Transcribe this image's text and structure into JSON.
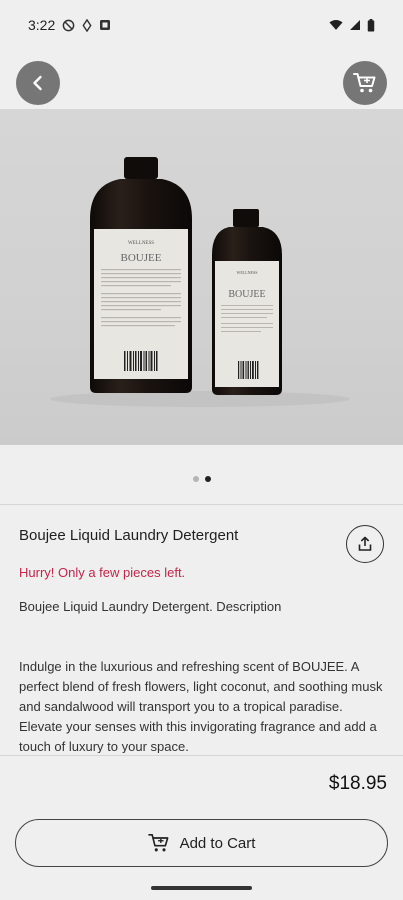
{
  "status_bar": {
    "time": "3:22"
  },
  "product": {
    "title": "Boujee Liquid Laundry Detergent",
    "stock_warning": "Hurry! Only a few pieces left.",
    "short_description": "Boujee Liquid Laundry Detergent. Description",
    "long_description": "Indulge in the luxurious and refreshing scent of BOUJEE. A perfect blend of fresh flowers, light coconut, and soothing musk and sandalwood will transport you to a tropical paradise. Elevate your senses with this invigorating fragrance and add a touch of luxury to your space.",
    "price": "$18.95",
    "image_label": "BOUJEE",
    "image_brand": "WELLNESS"
  },
  "carousel": {
    "count": 2,
    "active_index": 1
  },
  "actions": {
    "add_to_cart_label": "Add to Cart"
  },
  "colors": {
    "accent_warning": "#c2264a",
    "icon_button_bg": "#767676"
  },
  "icons": [
    "back-arrow-icon",
    "cart-icon",
    "share-icon",
    "wifi-icon",
    "signal-icon",
    "battery-icon"
  ]
}
